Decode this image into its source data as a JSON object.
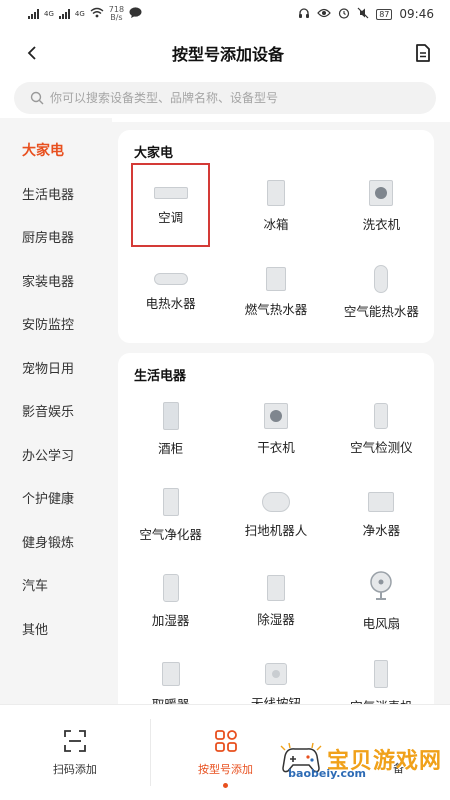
{
  "status": {
    "left_signal_1": "4G",
    "left_signal_2": "4G",
    "net_speed_value": "718",
    "net_speed_unit": "B/s",
    "battery": "87",
    "time": "09:46"
  },
  "header": {
    "title": "按型号添加设备"
  },
  "search": {
    "placeholder": "你可以搜索设备类型、品牌名称、设备型号"
  },
  "sidebar": {
    "items": [
      {
        "label": "大家电",
        "active": true
      },
      {
        "label": "生活电器"
      },
      {
        "label": "厨房电器"
      },
      {
        "label": "家装电器"
      },
      {
        "label": "安防监控"
      },
      {
        "label": "宠物日用"
      },
      {
        "label": "影音娱乐"
      },
      {
        "label": "办公学习"
      },
      {
        "label": "个护健康"
      },
      {
        "label": "健身锻炼"
      },
      {
        "label": "汽车"
      },
      {
        "label": "其他"
      }
    ]
  },
  "sections": [
    {
      "title": "大家电",
      "items": [
        {
          "label": "空调",
          "icon": "air-conditioner-icon",
          "highlighted": true
        },
        {
          "label": "冰箱",
          "icon": "fridge-icon"
        },
        {
          "label": "洗衣机",
          "icon": "washing-machine-icon"
        },
        {
          "label": "电热水器",
          "icon": "electric-water-heater-icon"
        },
        {
          "label": "燃气热水器",
          "icon": "gas-water-heater-icon"
        },
        {
          "label": "空气能热水器",
          "icon": "air-energy-water-heater-icon"
        }
      ]
    },
    {
      "title": "生活电器",
      "items": [
        {
          "label": "酒柜",
          "icon": "wine-cabinet-icon"
        },
        {
          "label": "干衣机",
          "icon": "dryer-icon"
        },
        {
          "label": "空气检测仪",
          "icon": "air-monitor-icon"
        },
        {
          "label": "空气净化器",
          "icon": "air-purifier-icon"
        },
        {
          "label": "扫地机器人",
          "icon": "robot-vacuum-icon"
        },
        {
          "label": "净水器",
          "icon": "water-purifier-icon"
        },
        {
          "label": "加湿器",
          "icon": "humidifier-icon"
        },
        {
          "label": "除湿器",
          "icon": "dehumidifier-icon"
        },
        {
          "label": "电风扇",
          "icon": "fan-icon"
        },
        {
          "label": "取暖器",
          "icon": "heater-icon"
        },
        {
          "label": "无线按钮",
          "icon": "wireless-button-icon"
        },
        {
          "label": "空气消毒机",
          "icon": "air-sterilizer-icon"
        }
      ]
    }
  ],
  "bottom_nav": {
    "scan_label": "扫码添加",
    "model_label": "按型号添加",
    "third_label_partial": "备"
  },
  "watermark": {
    "text": "宝贝游戏网",
    "url": "baobeiy.com"
  },
  "colors": {
    "accent": "#e8501f",
    "highlight_border": "#d43a36"
  }
}
